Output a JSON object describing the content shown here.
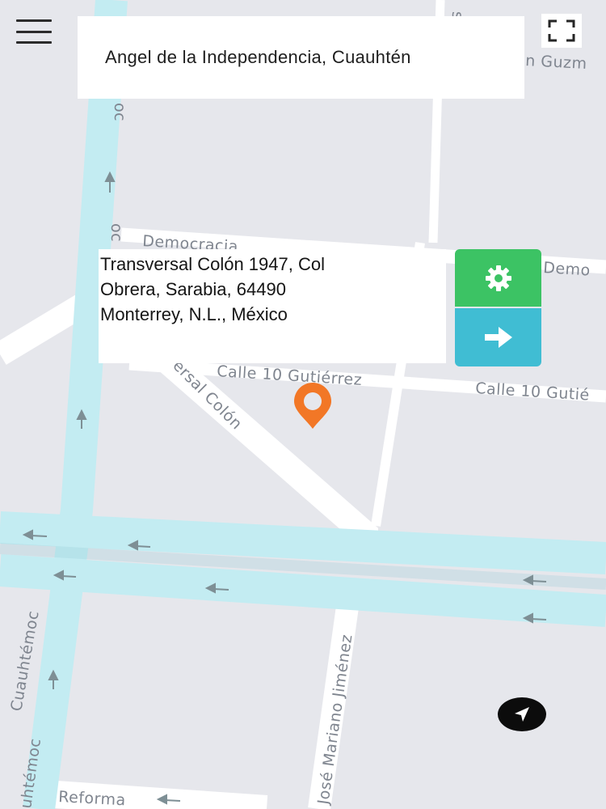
{
  "search": {
    "value": "Angel de la Independencia, Cuauhtén"
  },
  "address": {
    "lines": [
      "Transversal Colón 1947, Col",
      "Obrera, Sarabia, 64490",
      "Monterrey, N.L., México"
    ]
  },
  "map": {
    "street_labels": {
      "democracia_left": "Democracia",
      "democracia_right": "Demo",
      "calle10_left": "Calle 10 Gutiérrez",
      "calle10_right": "Calle 10 Gutié",
      "transversal": "ersal Colón",
      "cuauhtemoc_top": "oc",
      "cuauhtemoc_mid": "oc",
      "cuauhtemoc_left": "Cuauhtémoc",
      "cuauhtemoc_bottom": "uhtémoc",
      "jose_mariano": "José Mariano Jiménez",
      "reforma": "Reforma",
      "top_partial_1": "n Guzm",
      "top_partial_2": "s"
    }
  },
  "colors": {
    "map_background": "#e6e7ec",
    "highway": "#c3ecf2",
    "street": "#ffffff",
    "settings_button": "#3cc364",
    "go_button": "#40bdd3",
    "marker": "#f27726"
  },
  "icons": {
    "menu": "hamburger-icon",
    "fullscreen": "fullscreen-icon",
    "settings": "gear-icon",
    "go": "arrow-right-icon",
    "marker": "map-pin-icon",
    "locate": "navigation-arrow-icon"
  }
}
